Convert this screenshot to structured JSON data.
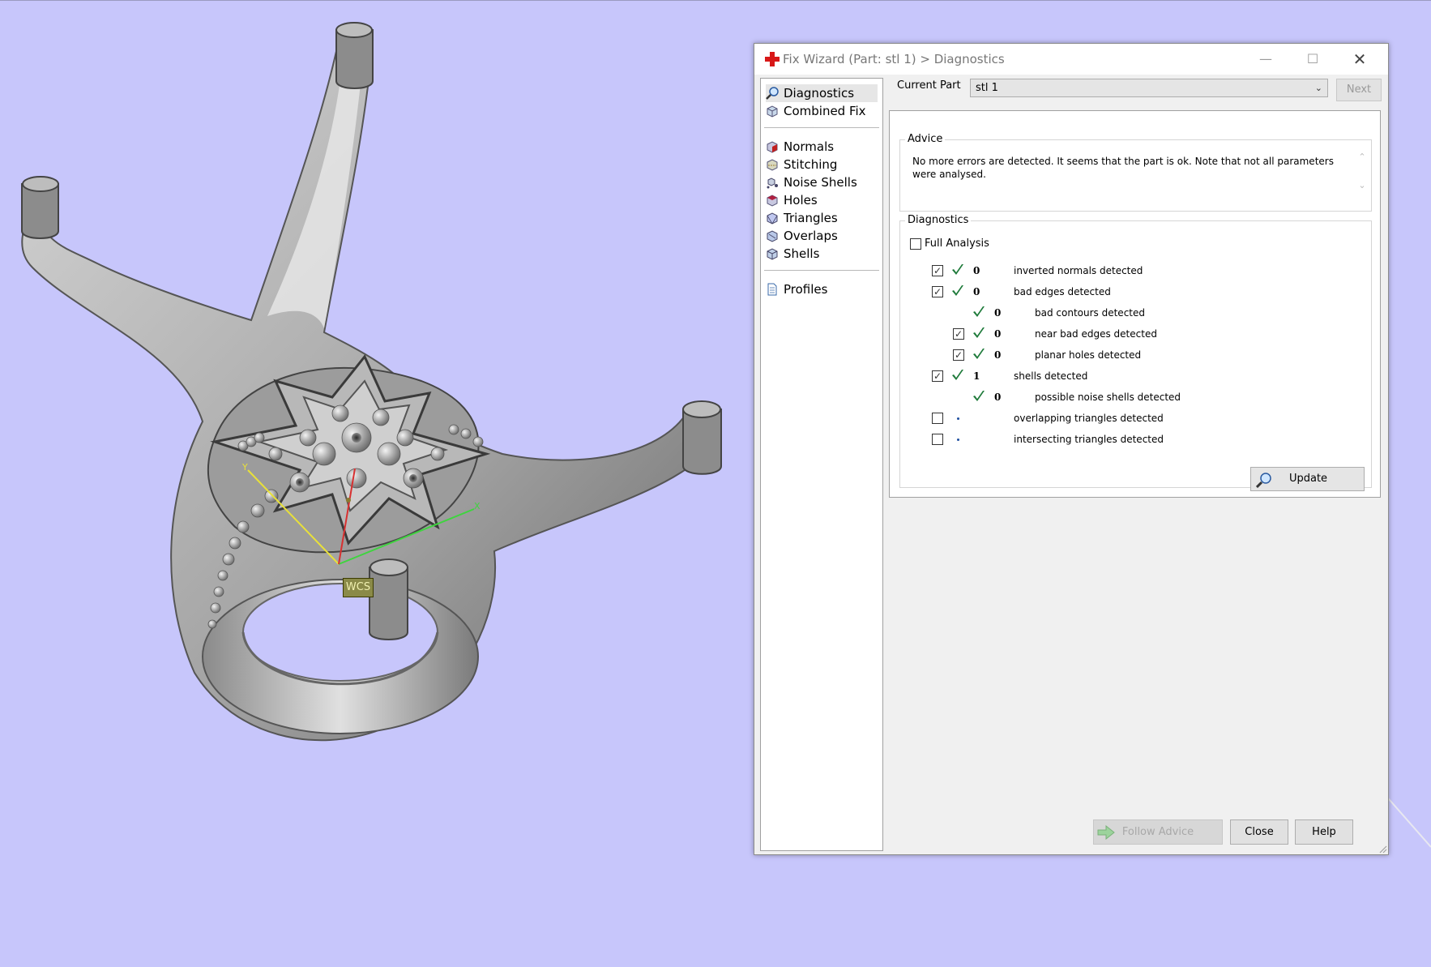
{
  "window": {
    "title": "Fix Wizard (Part: stl 1) > Diagnostics"
  },
  "viewport": {
    "wcs_label": "WCS"
  },
  "sidebar": {
    "top_items": [
      {
        "label": "Diagnostics",
        "icon": "magnifier-icon",
        "selected": true
      },
      {
        "label": "Combined Fix",
        "icon": "cube-icon"
      }
    ],
    "fix_items": [
      {
        "label": "Normals",
        "icon": "normals-cube-icon"
      },
      {
        "label": "Stitching",
        "icon": "stitching-cube-icon"
      },
      {
        "label": "Noise Shells",
        "icon": "noise-shells-icon"
      },
      {
        "label": "Holes",
        "icon": "holes-cube-icon"
      },
      {
        "label": "Triangles",
        "icon": "triangles-cube-icon"
      },
      {
        "label": "Overlaps",
        "icon": "overlaps-cube-icon"
      },
      {
        "label": "Shells",
        "icon": "shells-cube-icon"
      }
    ],
    "bottom_items": [
      {
        "label": "Profiles",
        "icon": "document-icon"
      }
    ]
  },
  "current_part": {
    "label": "Current Part",
    "value": "stl 1"
  },
  "next_button": "Next",
  "advice": {
    "legend": "Advice",
    "text": "No more errors are detected. It seems that the part is ok. Note that not all parameters were analysed."
  },
  "diagnostics": {
    "legend": "Diagnostics",
    "full_analysis_label": "Full Analysis",
    "full_analysis_checked": false,
    "rows": [
      {
        "checkbox": true,
        "checked": true,
        "status": "ok",
        "count": "0",
        "text": "inverted normals detected",
        "indent": 0
      },
      {
        "checkbox": true,
        "checked": true,
        "status": "ok",
        "count": "0",
        "text": "bad edges detected",
        "indent": 0
      },
      {
        "checkbox": false,
        "checked": false,
        "status": "ok",
        "count": "0",
        "text": "bad contours detected",
        "indent": 1
      },
      {
        "checkbox": true,
        "checked": true,
        "status": "ok",
        "count": "0",
        "text": "near bad edges detected",
        "indent": 1
      },
      {
        "checkbox": true,
        "checked": true,
        "status": "ok",
        "count": "0",
        "text": "planar holes detected",
        "indent": 1
      },
      {
        "checkbox": true,
        "checked": true,
        "status": "ok",
        "count": "1",
        "text": "shells detected",
        "indent": 0
      },
      {
        "checkbox": false,
        "checked": false,
        "status": "ok",
        "count": "0",
        "text": "possible noise shells detected",
        "indent": 1
      },
      {
        "checkbox": true,
        "checked": false,
        "status": "pending",
        "count": "",
        "text": "overlapping triangles detected",
        "indent": 0
      },
      {
        "checkbox": true,
        "checked": false,
        "status": "pending",
        "count": "",
        "text": "intersecting triangles detected",
        "indent": 0
      }
    ],
    "update_button": "Update"
  },
  "buttons": {
    "follow_advice": "Follow Advice",
    "close": "Close",
    "help": "Help"
  },
  "colors": {
    "viewport_background": "#c7c6fb",
    "check_green": "#1e7a3a",
    "x_axis": "#3fd43f",
    "y_axis": "#e8e03a",
    "z_axis": "#d83030"
  }
}
